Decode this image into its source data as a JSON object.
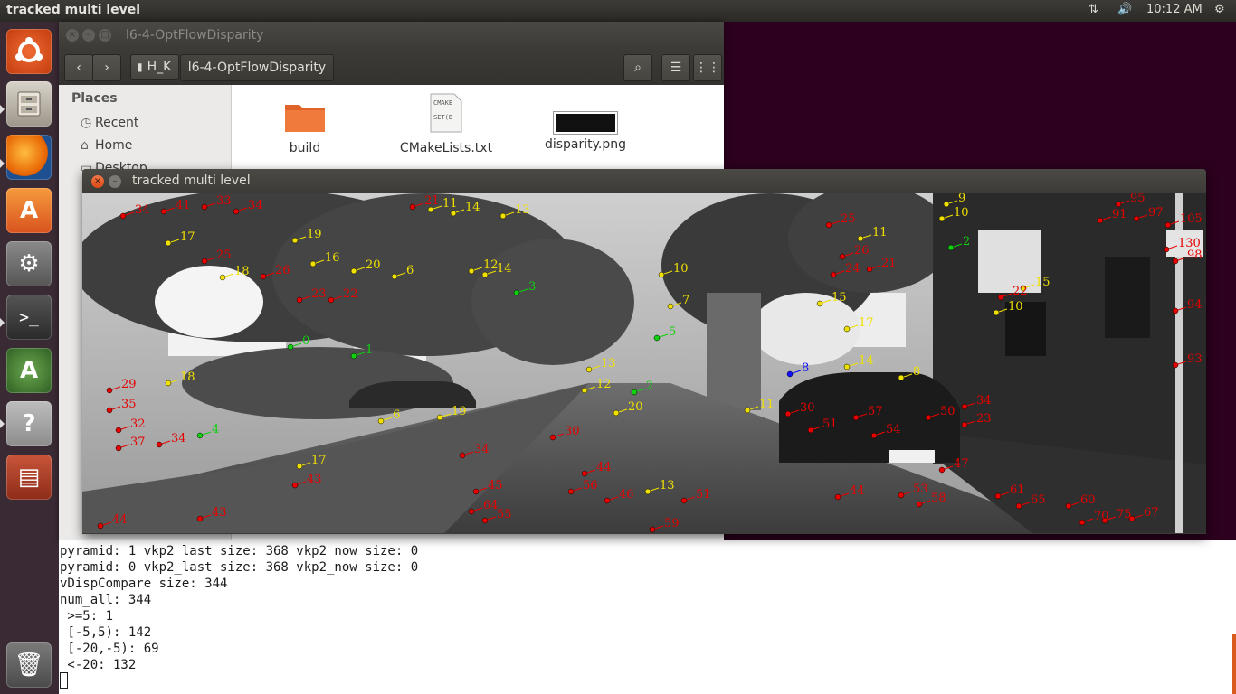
{
  "panel": {
    "active_title": "tracked multi level",
    "clock": "10:12 AM",
    "network_icon": "network-updown-icon",
    "sound_icon": "volume-icon",
    "settings_icon": "gear-icon"
  },
  "launcher": {
    "items": [
      {
        "name": "ubuntu-dash",
        "icon": "ubuntu-logo-icon",
        "color": "#dd4814"
      },
      {
        "name": "files",
        "icon": "file-cabinet-icon",
        "color": "#8a7a6a"
      },
      {
        "name": "firefox",
        "icon": "firefox-icon",
        "color": "#e66000"
      },
      {
        "name": "software-center",
        "icon": "shopping-bag-icon",
        "color": "#e36e1e"
      },
      {
        "name": "system-settings",
        "icon": "wrench-gear-icon",
        "color": "#6a6a6a"
      },
      {
        "name": "terminal",
        "icon": "terminal-icon",
        "color": "#2d2d2d"
      },
      {
        "name": "software-updater",
        "icon": "updater-icon",
        "color": "#4c7a3a"
      },
      {
        "name": "help",
        "icon": "question-icon",
        "color": "#9a9a9a"
      },
      {
        "name": "system-monitor",
        "icon": "monitor-icon",
        "color": "#b3452a"
      },
      {
        "name": "trash",
        "icon": "trash-icon",
        "color": "#6a6a6a"
      }
    ]
  },
  "file_manager": {
    "title": "l6-4-OptFlowDisparity",
    "path_home": "H_K",
    "path_current": "l6-4-OptFlowDisparity",
    "sidebar_heading": "Places",
    "sidebar_items": [
      "Recent",
      "Home",
      "Desktop"
    ],
    "files": [
      {
        "name": "build",
        "type": "folder"
      },
      {
        "name": "CMakeLists.txt",
        "type": "text",
        "preview": "CMAKE\nSET(B"
      },
      {
        "name": "disparity.png",
        "type": "image"
      }
    ]
  },
  "cv_window": {
    "title": "tracked multi level"
  },
  "terminal": {
    "lines": [
      "pyramid: 1 vkp2_last size: 368 vkp2_now size: 0",
      "pyramid: 0 vkp2_last size: 368 vkp2_now size: 0",
      "vDispCompare size: 344",
      "num_all: 344",
      " >=5: 1",
      " [-5,5): 142",
      " [-20,-5): 69",
      " <-20: 132"
    ]
  },
  "tracked_points": {
    "colors": {
      "far": "#e60000",
      "mid": "#f0e000",
      "near": "#10d010",
      "other": "#1010ff"
    },
    "items": [
      {
        "l": "34",
        "c": "far"
      },
      {
        "l": "41",
        "c": "far"
      },
      {
        "l": "33",
        "c": "far"
      },
      {
        "l": "34",
        "c": "far"
      },
      {
        "l": "21",
        "c": "far"
      },
      {
        "l": "11",
        "c": "mid"
      },
      {
        "l": "14",
        "c": "mid"
      },
      {
        "l": "13",
        "c": "mid"
      },
      {
        "l": "17",
        "c": "mid"
      },
      {
        "l": "19",
        "c": "mid"
      },
      {
        "l": "25",
        "c": "far"
      },
      {
        "l": "18",
        "c": "mid"
      },
      {
        "l": "26",
        "c": "far"
      },
      {
        "l": "16",
        "c": "mid"
      },
      {
        "l": "20",
        "c": "mid"
      },
      {
        "l": "6",
        "c": "mid"
      },
      {
        "l": "14",
        "c": "mid"
      },
      {
        "l": "12",
        "c": "mid"
      },
      {
        "l": "22",
        "c": "far"
      },
      {
        "l": "23",
        "c": "far"
      },
      {
        "l": "0",
        "c": "near"
      },
      {
        "l": "1",
        "c": "near"
      },
      {
        "l": "29",
        "c": "far"
      },
      {
        "l": "35",
        "c": "far"
      },
      {
        "l": "32",
        "c": "far"
      },
      {
        "l": "37",
        "c": "far"
      },
      {
        "l": "34",
        "c": "far"
      },
      {
        "l": "44",
        "c": "far"
      },
      {
        "l": "43",
        "c": "far"
      },
      {
        "l": "18",
        "c": "mid"
      },
      {
        "l": "6",
        "c": "mid"
      },
      {
        "l": "19",
        "c": "mid"
      },
      {
        "l": "4",
        "c": "near"
      },
      {
        "l": "17",
        "c": "mid"
      },
      {
        "l": "43",
        "c": "far"
      },
      {
        "l": "34",
        "c": "far"
      },
      {
        "l": "30",
        "c": "far"
      },
      {
        "l": "45",
        "c": "far"
      },
      {
        "l": "64",
        "c": "far"
      },
      {
        "l": "55",
        "c": "far"
      },
      {
        "l": "13",
        "c": "mid"
      },
      {
        "l": "12",
        "c": "mid"
      },
      {
        "l": "20",
        "c": "mid"
      },
      {
        "l": "2",
        "c": "near"
      },
      {
        "l": "44",
        "c": "far"
      },
      {
        "l": "56",
        "c": "far"
      },
      {
        "l": "46",
        "c": "far"
      },
      {
        "l": "13",
        "c": "mid"
      },
      {
        "l": "51",
        "c": "far"
      },
      {
        "l": "59",
        "c": "far"
      },
      {
        "l": "8",
        "c": "other"
      },
      {
        "l": "11",
        "c": "mid"
      },
      {
        "l": "30",
        "c": "far"
      },
      {
        "l": "51",
        "c": "far"
      },
      {
        "l": "57",
        "c": "far"
      },
      {
        "l": "54",
        "c": "far"
      },
      {
        "l": "50",
        "c": "far"
      },
      {
        "l": "34",
        "c": "far"
      },
      {
        "l": "23",
        "c": "far"
      },
      {
        "l": "47",
        "c": "far"
      },
      {
        "l": "14",
        "c": "mid"
      },
      {
        "l": "8",
        "c": "mid"
      },
      {
        "l": "9",
        "c": "mid"
      },
      {
        "l": "10",
        "c": "mid"
      },
      {
        "l": "2",
        "c": "near"
      },
      {
        "l": "15",
        "c": "mid"
      },
      {
        "l": "22",
        "c": "far"
      },
      {
        "l": "10",
        "c": "mid"
      },
      {
        "l": "95",
        "c": "far"
      },
      {
        "l": "91",
        "c": "far"
      },
      {
        "l": "97",
        "c": "far"
      },
      {
        "l": "105",
        "c": "far"
      },
      {
        "l": "130",
        "c": "far"
      },
      {
        "l": "98",
        "c": "far"
      },
      {
        "l": "94",
        "c": "far"
      },
      {
        "l": "93",
        "c": "far"
      },
      {
        "l": "61",
        "c": "far"
      },
      {
        "l": "65",
        "c": "far"
      },
      {
        "l": "60",
        "c": "far"
      },
      {
        "l": "70",
        "c": "far"
      },
      {
        "l": "75",
        "c": "far"
      },
      {
        "l": "67",
        "c": "far"
      },
      {
        "l": "44",
        "c": "far"
      },
      {
        "l": "53",
        "c": "far"
      },
      {
        "l": "58",
        "c": "far"
      },
      {
        "l": "24",
        "c": "far"
      },
      {
        "l": "21",
        "c": "far"
      },
      {
        "l": "26",
        "c": "far"
      },
      {
        "l": "15",
        "c": "mid"
      },
      {
        "l": "11",
        "c": "mid"
      },
      {
        "l": "25",
        "c": "far"
      },
      {
        "l": "17",
        "c": "mid"
      },
      {
        "l": "7",
        "c": "mid"
      },
      {
        "l": "10",
        "c": "mid"
      },
      {
        "l": "5",
        "c": "near"
      },
      {
        "l": "3",
        "c": "near"
      }
    ]
  }
}
